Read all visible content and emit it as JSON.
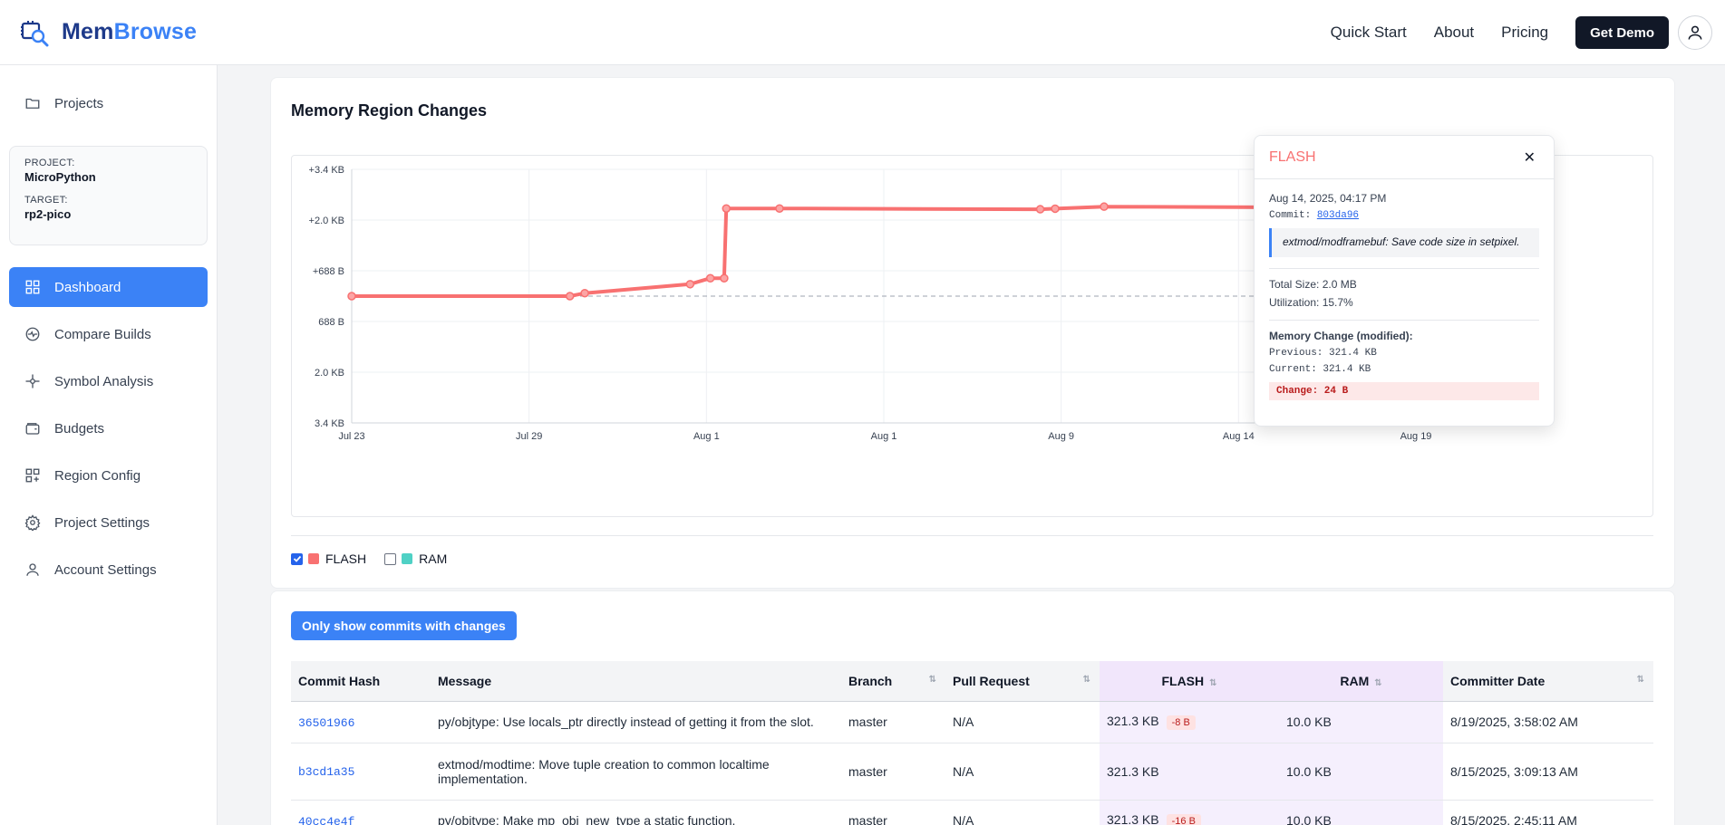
{
  "header": {
    "brand_first": "Mem",
    "brand_second": "Browse",
    "nav": [
      "Quick Start",
      "About",
      "Pricing"
    ],
    "demo_button": "Get Demo"
  },
  "sidebar": {
    "projects_label": "Projects",
    "project_label": "PROJECT:",
    "project_value": "MicroPython",
    "target_label": "TARGET:",
    "target_value": "rp2-pico",
    "items": [
      {
        "label": "Dashboard",
        "icon": "dashboard-icon",
        "active": true
      },
      {
        "label": "Compare Builds",
        "icon": "compare-icon"
      },
      {
        "label": "Symbol Analysis",
        "icon": "symbol-icon"
      },
      {
        "label": "Budgets",
        "icon": "wallet-icon"
      },
      {
        "label": "Region Config",
        "icon": "region-config-icon"
      },
      {
        "label": "Project Settings",
        "icon": "gear-icon"
      },
      {
        "label": "Account Settings",
        "icon": "user-icon"
      }
    ]
  },
  "chart_data": {
    "type": "line",
    "title": "Memory Region Changes",
    "y_ticks": [
      "+3.4 KB",
      "+2.0 KB",
      "+688 B",
      "688 B",
      "2.0 KB",
      "3.4 KB"
    ],
    "x_ticks": [
      "Jul 23",
      "Jul 29",
      "Aug 1",
      "Aug 1",
      "Aug 9",
      "Aug 14",
      "Aug 19"
    ],
    "series": [
      {
        "name": "FLASH",
        "color": "#f87171",
        "points": [
          {
            "x": "Jul 23",
            "y": 0
          },
          {
            "x": "Jul 30",
            "y": 0
          },
          {
            "x": "Jul 31",
            "y": 80
          },
          {
            "x": "Aug 1a",
            "y": 320
          },
          {
            "x": "Aug 1b",
            "y": 480
          },
          {
            "x": "Aug 1c",
            "y": 480
          },
          {
            "x": "Aug 1d",
            "y": 2350
          },
          {
            "x": "Aug 2",
            "y": 2350
          },
          {
            "x": "Aug 8",
            "y": 2330
          },
          {
            "x": "Aug 9",
            "y": 2345
          },
          {
            "x": "Aug 10",
            "y": 2400
          },
          {
            "x": "Aug 19",
            "y": 2370
          }
        ]
      },
      {
        "name": "RAM",
        "color": "#4fd1c5",
        "points": []
      }
    ],
    "legend": [
      {
        "name": "FLASH",
        "checked": true,
        "color": "#f87171"
      },
      {
        "name": "RAM",
        "checked": false,
        "color": "#4fd1c5"
      }
    ]
  },
  "tooltip": {
    "title": "FLASH",
    "date": "Aug 14, 2025, 04:17 PM",
    "commit_label": "Commit:",
    "commit_hash": "803da96",
    "message": "extmod/modframebuf: Save code size in setpixel.",
    "total_size": "Total Size: 2.0 MB",
    "utilization": "Utilization: 15.7%",
    "change_heading": "Memory Change (modified):",
    "previous": "Previous: 321.4 KB",
    "current": "Current: 321.4 KB",
    "change": "Change: 24 B"
  },
  "table": {
    "filter_button": "Only show commits with changes",
    "headers": [
      "Commit Hash",
      "Message",
      "Branch",
      "Pull Request",
      "FLASH",
      "RAM",
      "Committer Date"
    ],
    "rows": [
      {
        "hash": "36501966",
        "message": "py/objtype: Use locals_ptr directly instead of getting it from the slot.",
        "branch": "master",
        "pr": "N/A",
        "flash": "321.3 KB",
        "flash_delta": "-8 B",
        "ram": "10.0 KB",
        "date": "8/19/2025, 3:58:02 AM"
      },
      {
        "hash": "b3cd1a35",
        "message": "extmod/modtime: Move tuple creation to common localtime implementation.",
        "branch": "master",
        "pr": "N/A",
        "flash": "321.3 KB",
        "flash_delta": "",
        "ram": "10.0 KB",
        "date": "8/15/2025, 3:09:13 AM"
      },
      {
        "hash": "40cc4e4f",
        "message": "py/objtype: Make mp_obj_new_type a static function.",
        "branch": "master",
        "pr": "N/A",
        "flash": "321.3 KB",
        "flash_delta": "-16 B",
        "ram": "10.0 KB",
        "date": "8/15/2025, 2:45:11 AM"
      }
    ]
  }
}
